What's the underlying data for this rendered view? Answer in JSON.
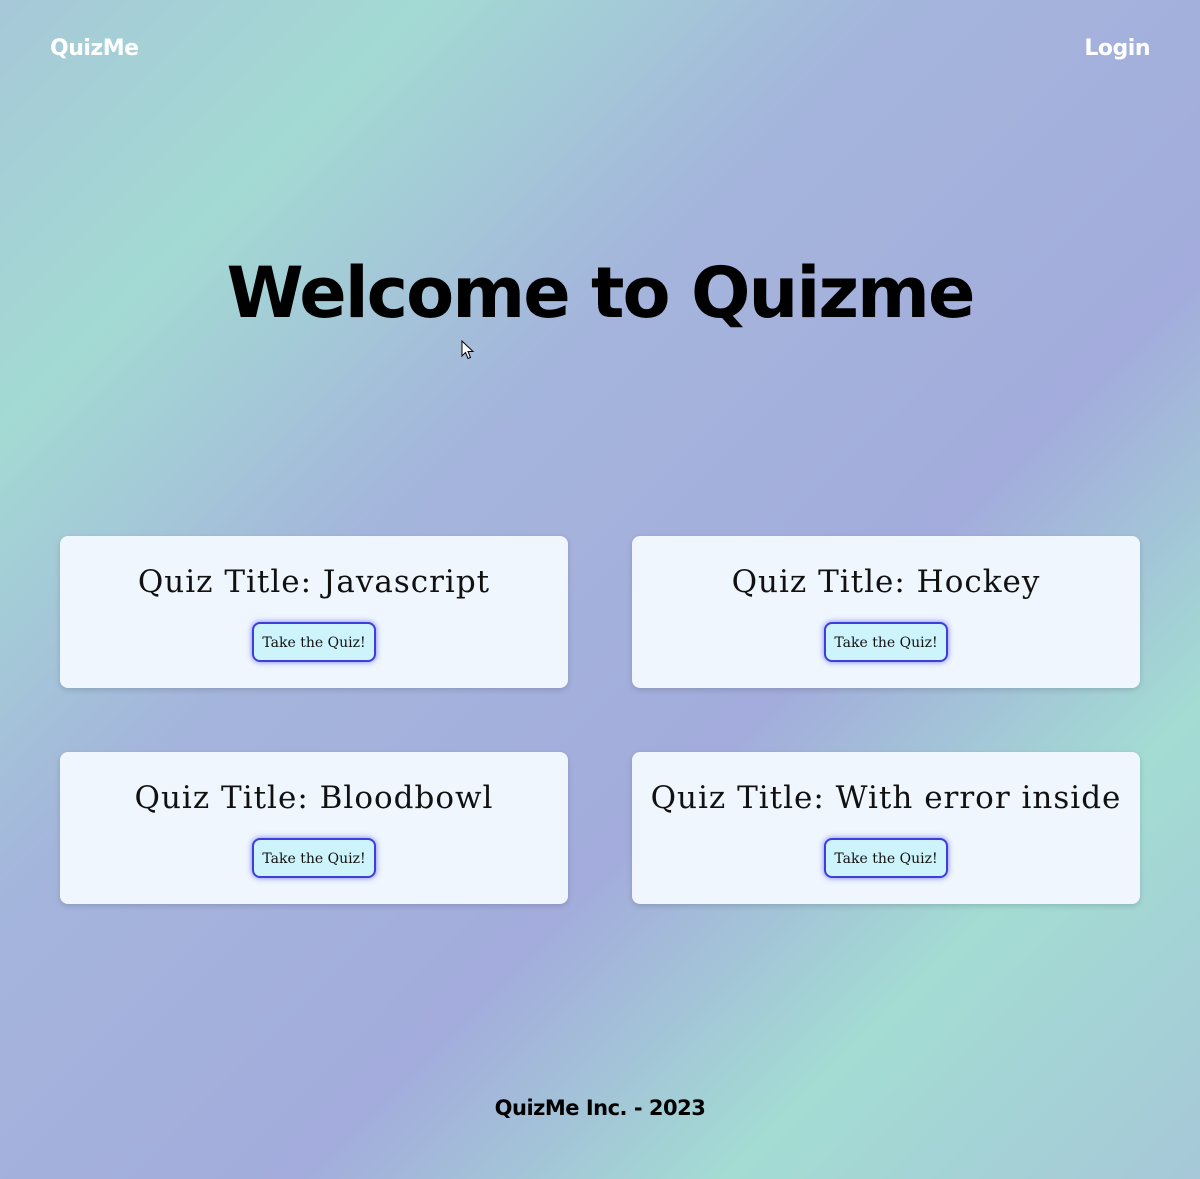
{
  "nav": {
    "brand": "QuizMe",
    "login_label": "Login"
  },
  "hero": {
    "title": "Welcome to Quizme"
  },
  "quizzes": [
    {
      "title": "Quiz Title: Javascript",
      "button_label": "Take the Quiz!"
    },
    {
      "title": "Quiz Title: Hockey",
      "button_label": "Take the Quiz!"
    },
    {
      "title": "Quiz Title: Bloodbowl",
      "button_label": "Take the Quiz!"
    },
    {
      "title": "Quiz Title: With error inside",
      "button_label": "Take the Quiz!"
    }
  ],
  "footer": {
    "text": "QuizMe Inc. - 2023"
  },
  "colors": {
    "card_background": "#eff6fd",
    "button_background": "#cdf3fb",
    "button_border": "#3f3fd8",
    "nav_text": "#ffffff"
  },
  "icons": {
    "cursor": "mouse-pointer-icon"
  }
}
